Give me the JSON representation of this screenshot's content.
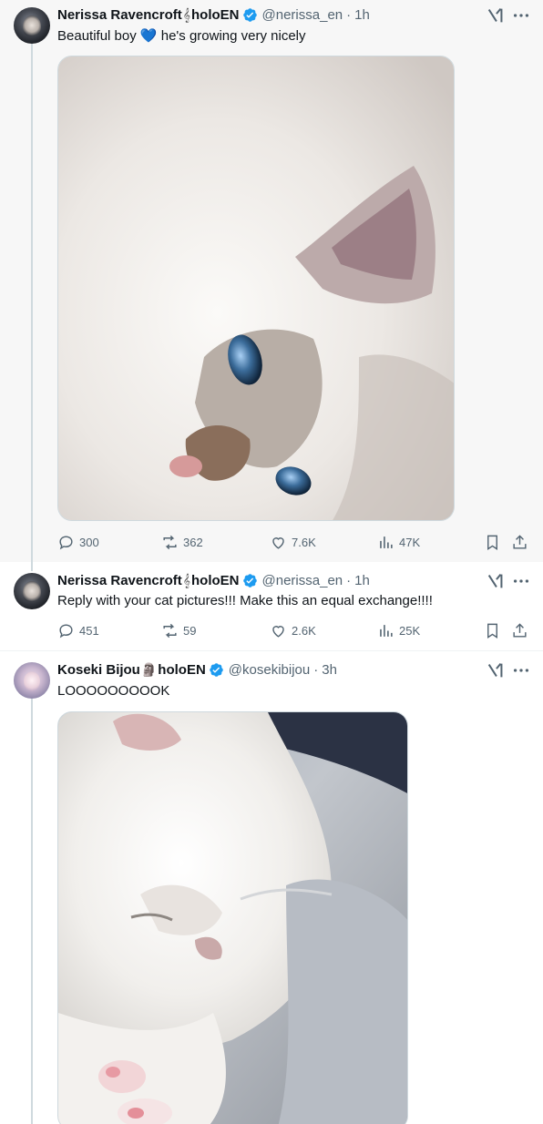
{
  "tweets": [
    {
      "display_name": "Nerissa Ravencroft",
      "name_suffix": "holoEN",
      "glyph": "𝄞",
      "handle": "@nerissa_en",
      "dot": "·",
      "time": "1h",
      "text": "Beautiful boy 💙 he's growing very nicely",
      "media": "cat-photo",
      "stats": {
        "replies": "300",
        "reposts": "362",
        "likes": "7.6K",
        "views": "47K"
      }
    },
    {
      "display_name": "Nerissa Ravencroft",
      "name_suffix": "holoEN",
      "glyph": "𝄞",
      "handle": "@nerissa_en",
      "dot": "·",
      "time": "1h",
      "text": "Reply with your cat pictures!!! Make this an equal exchange!!!!",
      "stats": {
        "replies": "451",
        "reposts": "59",
        "likes": "2.6K",
        "views": "25K"
      }
    },
    {
      "display_name": "Koseki Bijou",
      "name_suffix": "holoEN",
      "glyph": "🗿",
      "handle": "@kosekibijou",
      "dot": "·",
      "time": "3h",
      "text": "LOOOOOOOOOK",
      "media": "kitten-photo"
    }
  ],
  "icons": {
    "reply": "reply-icon",
    "repost": "repost-icon",
    "like": "like-icon",
    "views": "views-icon",
    "bookmark": "bookmark-icon",
    "share": "share-icon",
    "grok": "grok-icon",
    "more": "more-icon",
    "verified": "verified-badge-icon"
  },
  "colors": {
    "verified": "#1d9bf0",
    "secondary_text": "#536471",
    "thread_line": "#cfd9de",
    "highlight_bg": "#f7f7f7"
  }
}
